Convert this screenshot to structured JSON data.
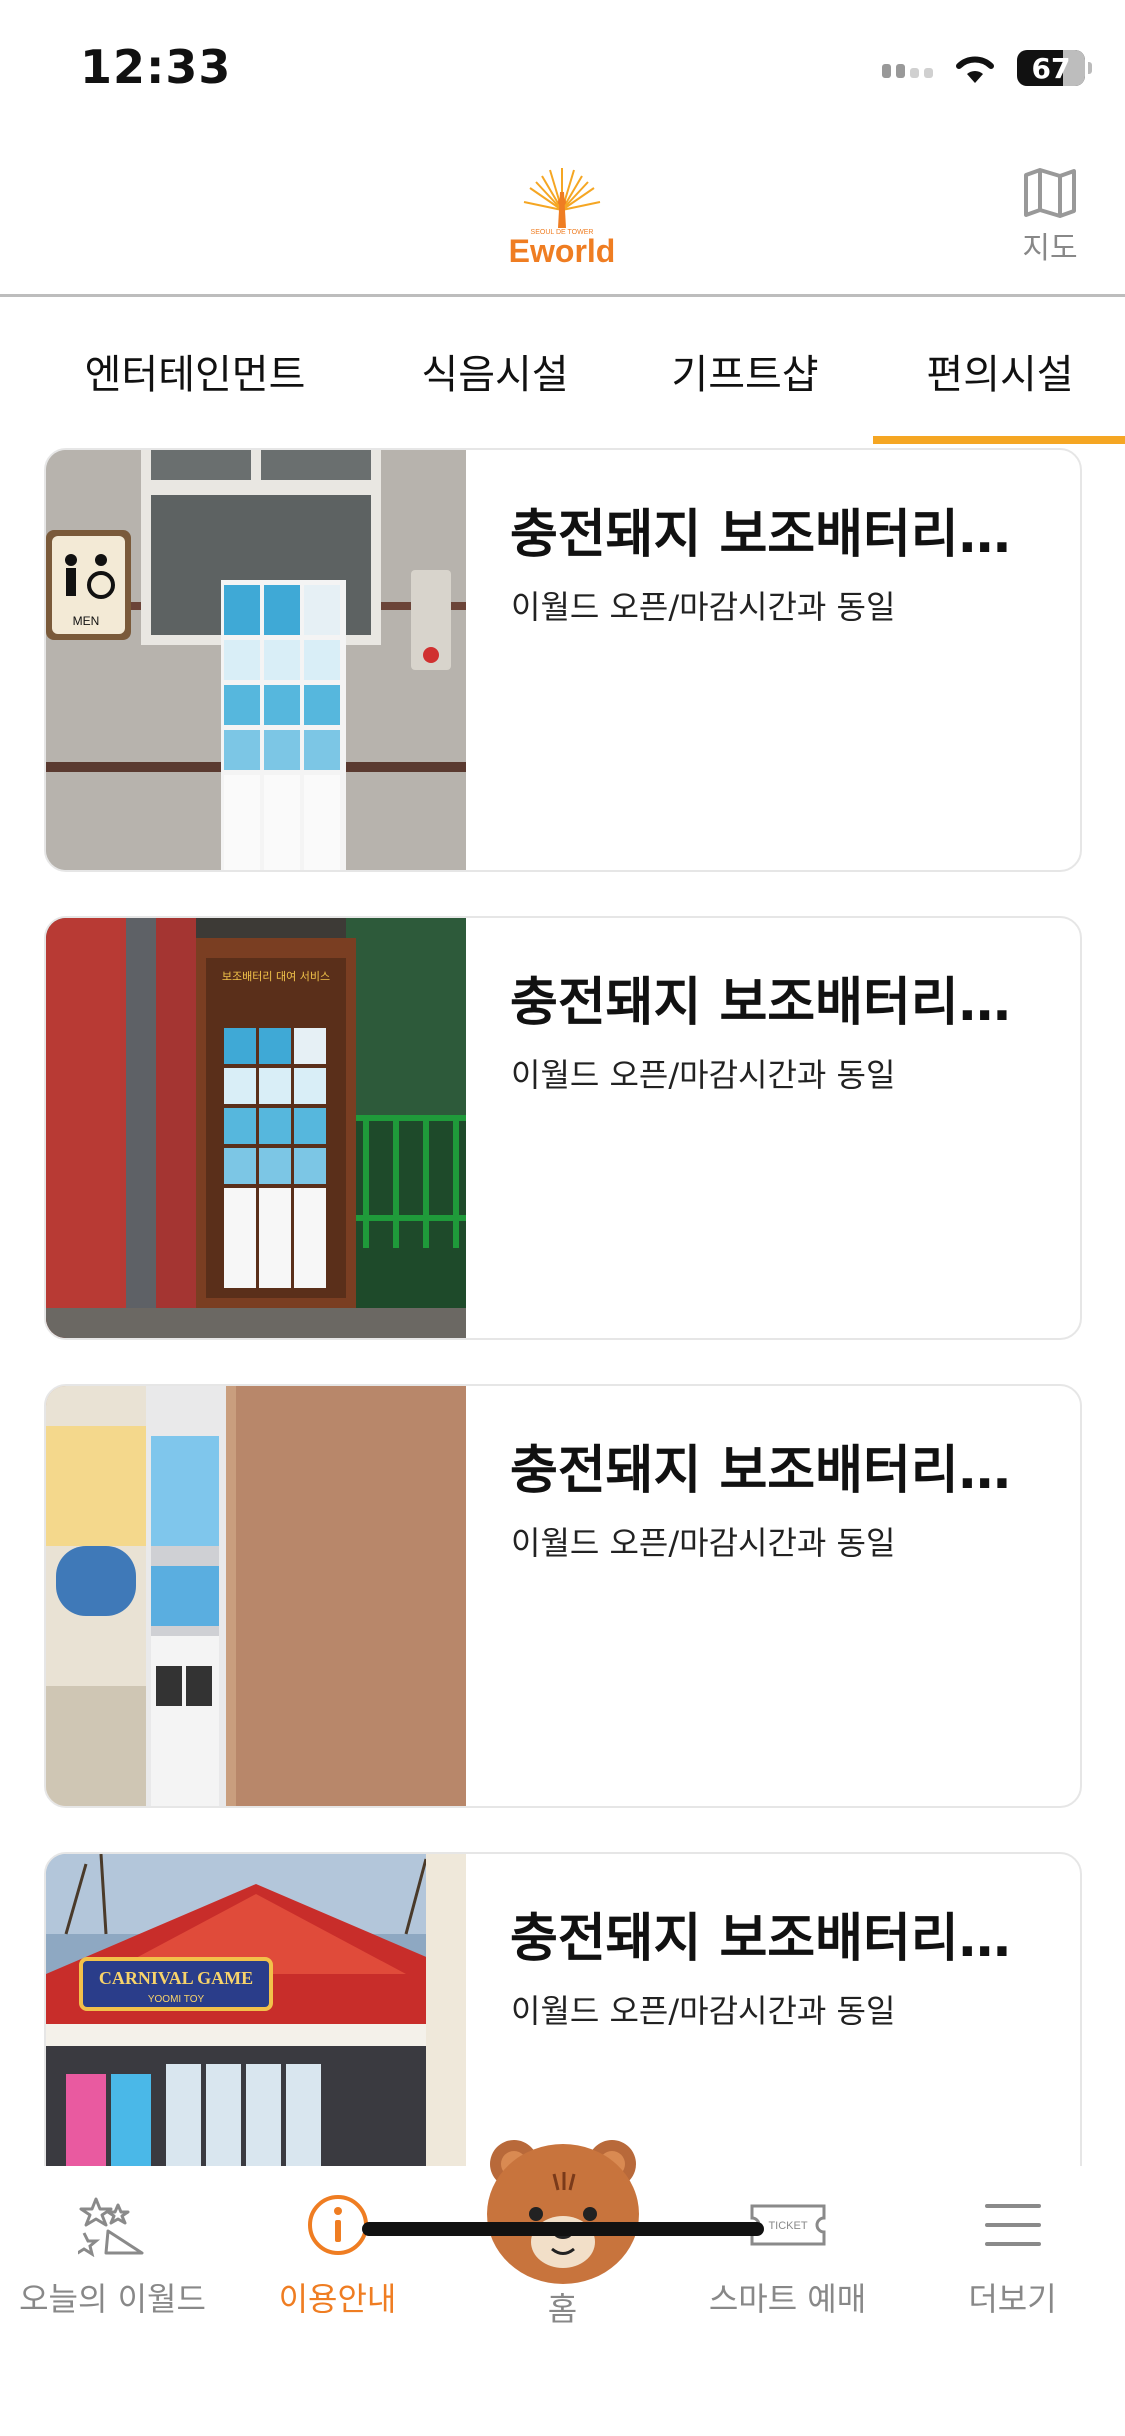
{
  "status_bar": {
    "time": "12:33",
    "battery": "67"
  },
  "header": {
    "logo_text": "Eworld",
    "logo_subtext": "SEOUL DE TOWER",
    "map_label": "지도"
  },
  "tabs": [
    {
      "label": "엔터테인먼트",
      "active": false
    },
    {
      "label": "식음시설",
      "active": false
    },
    {
      "label": "기프트샵",
      "active": false
    },
    {
      "label": "편의시설",
      "active": true
    }
  ],
  "accent_color": "#f5a623",
  "nav_active_color": "#ef7d22",
  "items": [
    {
      "title": "충전돼지 보조배터리…",
      "subtitle": "이월드 오픈/마감시간과 동일"
    },
    {
      "title": "충전돼지 보조배터리…",
      "subtitle": "이월드 오픈/마감시간과 동일"
    },
    {
      "title": "충전돼지 보조배터리…",
      "subtitle": "이월드 오픈/마감시간과 동일"
    },
    {
      "title": "충전돼지 보조배터리…",
      "subtitle": "이월드 오픈/마감시간과 동일"
    }
  ],
  "photo_text": {
    "men_sign": "MEN",
    "rental_sign": "보조배터리 대여 서비스",
    "carnival": "CARNIVAL GAME",
    "carnival_sub": "YOOMI TOY"
  },
  "bottom_nav": [
    {
      "label": "오늘의 이월드",
      "icon": "sparkle-icon",
      "active": false
    },
    {
      "label": "이용안내",
      "icon": "info-icon",
      "active": true
    },
    {
      "label": "홈",
      "icon": "bear-home-icon",
      "active": false
    },
    {
      "label": "스마트 예매",
      "icon": "ticket-icon",
      "active": false,
      "icon_text": "TICKET"
    },
    {
      "label": "더보기",
      "icon": "menu-icon",
      "active": false
    }
  ]
}
